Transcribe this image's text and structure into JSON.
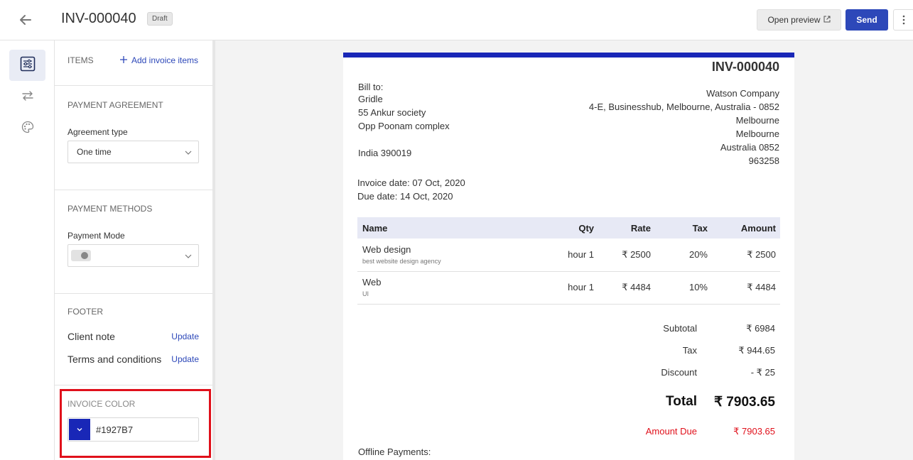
{
  "header": {
    "invoice_number": "INV-000040",
    "status_badge": "Draft",
    "preview_label": "Open preview",
    "send_label": "Send"
  },
  "rail": {
    "items": [
      {
        "icon": "settings-sliders-icon",
        "active": true
      },
      {
        "icon": "exchange-arrows-icon",
        "active": false
      },
      {
        "icon": "palette-icon",
        "active": false
      }
    ]
  },
  "panel": {
    "items": {
      "title": "ITEMS",
      "add_label": "Add invoice items"
    },
    "payment_agreement": {
      "title": "PAYMENT AGREEMENT",
      "field_label": "Agreement type",
      "value": "One time"
    },
    "payment_methods": {
      "title": "PAYMENT METHODS",
      "field_label": "Payment Mode",
      "value": ""
    },
    "footer": {
      "title": "FOOTER",
      "client_note": "Client note",
      "terms": "Terms and conditions",
      "update_label": "Update"
    },
    "invoice_color": {
      "title": "INVOICE COLOR",
      "value": "#1927B7"
    }
  },
  "invoice": {
    "number": "INV-000040",
    "bill_to_label": "Bill to:",
    "bill_to": [
      "Gridle",
      "55 Ankur society",
      "Opp Poonam complex",
      "",
      "India 390019"
    ],
    "from": [
      "Watson Company",
      "4-E, Businesshub, Melbourne, Australia - 0852",
      "Melbourne",
      "Melbourne",
      "Australia 0852",
      "963258"
    ],
    "invoice_date": "Invoice date: 07 Oct, 2020",
    "due_date": "Due date: 14 Oct, 2020",
    "columns": [
      "Name",
      "Qty",
      "Rate",
      "Tax",
      "Amount"
    ],
    "rows": [
      {
        "name": "Web design",
        "desc": "best website design agency",
        "qty": "hour 1",
        "rate": "₹ 2500",
        "tax": "20%",
        "amount": "₹ 2500"
      },
      {
        "name": "Web",
        "desc": "UI",
        "qty": "hour 1",
        "rate": "₹ 4484",
        "tax": "10%",
        "amount": "₹ 4484"
      }
    ],
    "subtotal_label": "Subtotal",
    "subtotal": "₹ 6984",
    "tax_label": "Tax",
    "tax": "₹ 944.65",
    "discount_label": "Discount",
    "discount": "- ₹ 25",
    "total_label": "Total",
    "total": "₹ 7903.65",
    "amount_due_label": "Amount Due",
    "amount_due": "₹ 7903.65",
    "offline_payments": "Offline Payments:"
  },
  "colors": {
    "accent": "#2d48b9",
    "invoice_color": "#1927B7",
    "highlight": "#e0101b",
    "amount_due": "#e0101b"
  }
}
